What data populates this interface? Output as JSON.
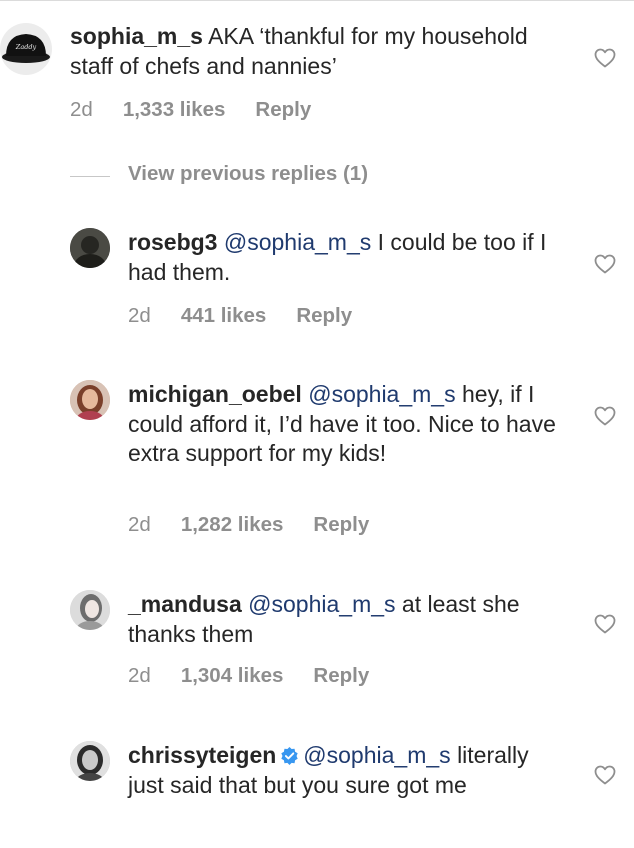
{
  "comments": [
    {
      "username": "sophia_m_s",
      "text": "AKA ‘thankful for my household staff of chefs and nannies’",
      "age": "2d",
      "likes": "1,333 likes",
      "reply": "Reply",
      "avatar_text": "Zaddy"
    },
    {
      "username": "rosebg3",
      "mention": "@sophia_m_s",
      "text": "I could be too if I had them.",
      "age": "2d",
      "likes": "441 likes",
      "reply": "Reply"
    },
    {
      "username": "michigan_oebel",
      "mention": "@sophia_m_s",
      "text": "hey, if I could afford it, I’d have it too. Nice to have extra support for my kids!",
      "age": "2d",
      "likes": "1,282 likes",
      "reply": "Reply"
    },
    {
      "username": "_mandusa",
      "mention": "@sophia_m_s",
      "text": "at least she thanks them",
      "age": "2d",
      "likes": "1,304 likes",
      "reply": "Reply"
    },
    {
      "username": "chrissyteigen",
      "mention": "@sophia_m_s",
      "text": "literally just said that but you sure got me"
    }
  ],
  "view_previous_replies": "View previous replies (1)",
  "colors": {
    "text": "#262626",
    "meta": "#8e8e8e",
    "mention": "#1f3a6e",
    "verified": "#3897f0"
  },
  "icons": {
    "like": "heart-outline-icon",
    "verified": "verified-badge-icon"
  }
}
